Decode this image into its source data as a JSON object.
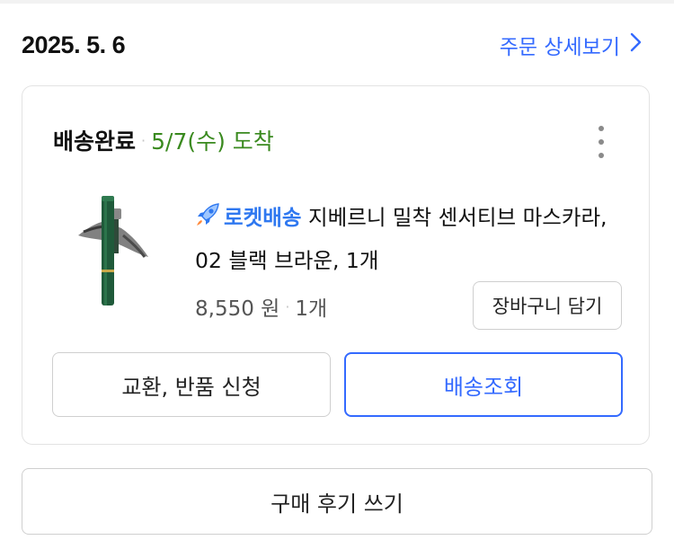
{
  "order": {
    "date": "2025. 5. 6",
    "detail_link_label": "주문 상세보기",
    "detail_link_icon": "chevron-right-icon"
  },
  "shipment": {
    "status": "배송완료",
    "arrival": "5/7(수) 도착",
    "menu_icon": "more-vertical-icon"
  },
  "product": {
    "badge_label": "로켓배송",
    "badge_icon": "rocket-icon",
    "name": "지베르니 밀착 센서티브 마스카라, 02 블랙 브라운, 1개",
    "price": "8,550 원",
    "quantity": "1개",
    "cart_button_label": "장바구니 담기"
  },
  "actions": {
    "exchange_label": "교환, 반품 신청",
    "track_label": "배송조회",
    "review_label": "구매 후기 쓰기"
  },
  "colors": {
    "accent_blue": "#346aff",
    "arrival_green": "#3a8a1f",
    "rocket_blue": "#2f78f0"
  }
}
